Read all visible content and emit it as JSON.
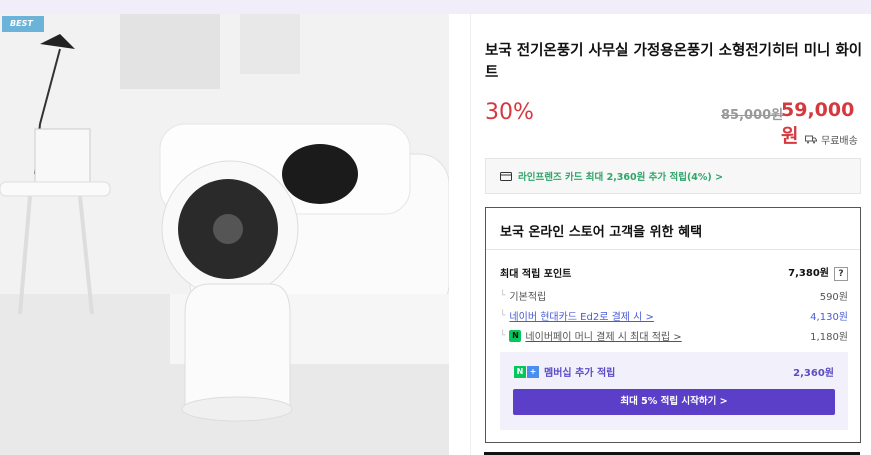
{
  "badge": "BEST",
  "product": {
    "title": "보국 전기온풍기 사무실 가정용온풍기 소형전기히터 미니 화이트",
    "discount": "30%",
    "original_price": "85,000원",
    "sale_price": "59,000원",
    "shipping": "무료배송"
  },
  "card_promo": "라인프렌즈 카드 최대 2,360원 추가 적립(4%) >",
  "benefit": {
    "title": "보국 온라인 스토어 고객을 위한 혜택",
    "max_points_label": "최대 적립 포인트",
    "max_points_value": "7,380원",
    "help": "?",
    "rows": [
      {
        "label": "기본적립",
        "value": "590원"
      },
      {
        "label": "네이버 현대카드 Ed2로 결제 시 >",
        "value": "4,130원"
      },
      {
        "label": "네이버페이 머니 결제 시 최대 적립 >",
        "value": "1,180원"
      }
    ],
    "npay_icon": "N",
    "membership_label": "멤버십 추가 적립",
    "membership_value": "2,360원",
    "start_button": "최대 5% 적립 시작하기 >"
  },
  "colors": {
    "accent_red": "#d6383f",
    "promo_green": "#2fa56a",
    "purple": "#5c3fc8",
    "link_blue": "#4a5bd4"
  },
  "icons": [
    "card-icon",
    "truck-icon",
    "npay-icon",
    "nplus-icon"
  ]
}
